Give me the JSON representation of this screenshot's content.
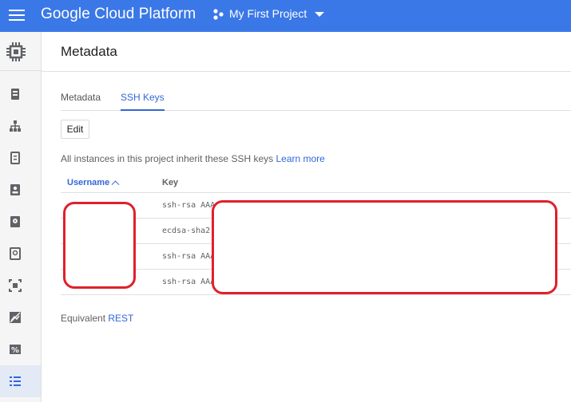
{
  "header": {
    "brand": "Google Cloud Platform",
    "project_name": "My First Project"
  },
  "sidebar": {
    "section_icon": "chip-icon",
    "items": [
      {
        "icon": "vm-instances-icon"
      },
      {
        "icon": "instance-groups-icon"
      },
      {
        "icon": "instance-templates-icon"
      },
      {
        "icon": "sole-tenant-icon"
      },
      {
        "icon": "disks-icon"
      },
      {
        "icon": "snapshots-icon"
      },
      {
        "icon": "images-icon"
      },
      {
        "icon": "tpus-icon"
      },
      {
        "icon": "committed-use-icon"
      },
      {
        "icon": "metadata-icon",
        "active": true
      }
    ]
  },
  "page": {
    "title": "Metadata",
    "tabs": [
      {
        "label": "Metadata",
        "active": false
      },
      {
        "label": "SSH Keys",
        "active": true
      }
    ],
    "edit_label": "Edit",
    "info_text": "All instances in this project inherit these SSH keys ",
    "learn_more": "Learn more",
    "table": {
      "columns": [
        "Username",
        "Key"
      ],
      "rows": [
        {
          "username": "",
          "key": "ssh-rsa AAA"
        },
        {
          "username": "",
          "key": "ecdsa-sha2"
        },
        {
          "username": "",
          "key": "ssh-rsa AAA"
        },
        {
          "username": "",
          "key": "ssh-rsa AAA"
        }
      ]
    },
    "equivalent_text": "Equivalent ",
    "rest_link": "REST"
  },
  "colors": {
    "header_bg": "#3b78e7",
    "accent": "#3367d6",
    "redaction": "#e0202c"
  }
}
